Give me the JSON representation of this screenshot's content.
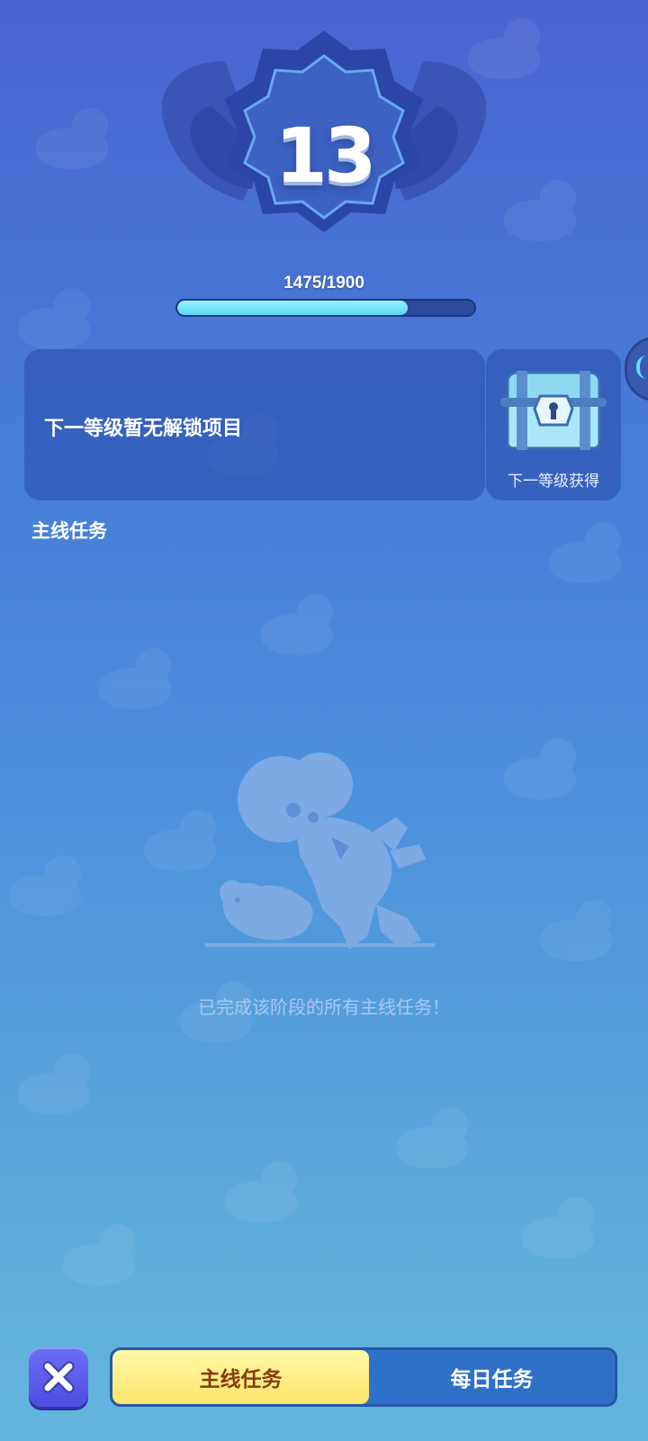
{
  "level": {
    "number": "13",
    "xp_text": "1475/1900",
    "xp_progress": 0.776
  },
  "unlock": {
    "message": "下一等级暂无解锁项目",
    "reward_label": "下一等级获得",
    "reward_icon": "treasure-chest-icon"
  },
  "section": {
    "title": "主线任务"
  },
  "empty_state": {
    "message": "已完成该阶段的所有主线任务！",
    "icon": "character-with-dog-illustration"
  },
  "bottom": {
    "close_icon": "close-icon",
    "tabs": [
      {
        "label": "主线任务",
        "active": true
      },
      {
        "label": "每日任务",
        "active": false
      }
    ]
  },
  "colors": {
    "active_tab": "#fde56a",
    "progress_fill": "#58d6f2",
    "close_button": "#5a5cea"
  }
}
